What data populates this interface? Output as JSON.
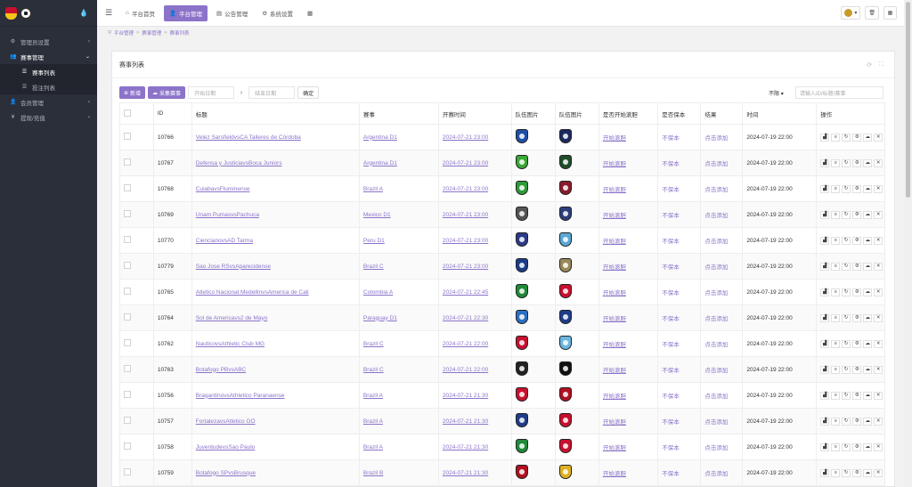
{
  "sidebar": {
    "menu": [
      {
        "label": "管理员设置",
        "icon": "gear-icon",
        "state": "closed"
      },
      {
        "label": "赛事管理",
        "icon": "users-icon",
        "state": "open"
      },
      {
        "label": "赛事列表",
        "icon": "list-icon",
        "state": "sub-active"
      },
      {
        "label": "投注列表",
        "icon": "list-icon",
        "state": "sub"
      },
      {
        "label": "会员管理",
        "icon": "user-icon",
        "state": "closed"
      },
      {
        "label": "提现/充值",
        "icon": "money-icon",
        "state": "closed"
      }
    ]
  },
  "topbar": {
    "tabs": [
      {
        "label": "平台首页",
        "icon": "home-icon",
        "active": false
      },
      {
        "label": "平台管理",
        "icon": "user-icon",
        "active": true
      },
      {
        "label": "公告管理",
        "icon": "notice-icon",
        "active": false
      },
      {
        "label": "系统设置",
        "icon": "gear-icon",
        "active": false
      }
    ]
  },
  "breadcrumb": [
    "平台管理",
    "赛事管理",
    "赛事列表"
  ],
  "panel": {
    "title": "赛事列表",
    "add_label": "新增",
    "collect_label": "采集赛事",
    "start_date_placeholder": "开始日期",
    "end_date_placeholder": "结束日期",
    "confirm_label": "确定",
    "filter_value": "不限",
    "search_placeholder": "请输入ID/标题/赛事"
  },
  "table": {
    "headers": [
      "ID",
      "标题",
      "赛事",
      "开赛时间",
      "队伍图片",
      "队伍图片",
      "是否开始滚胆",
      "是否保本",
      "结果",
      "时间",
      "操作"
    ],
    "rows": [
      {
        "id": "10766",
        "title": "Velez SarsfieldvsCA Talleres de Córdoba",
        "league": "Argentina D1",
        "start": "2024-07-21 23:00",
        "c1": "#1e4fa8",
        "c2": "#1a2b5e",
        "rolling": "开始滚胆",
        "protect": "不保本",
        "result": "点击添加",
        "time": "2024-07-19 22:00"
      },
      {
        "id": "10767",
        "title": "Defensa y JusticiavsBoca Juniors",
        "league": "Argentina D1",
        "start": "2024-07-21 23:00",
        "c1": "#3aa835",
        "c2": "#1f4d2a",
        "rolling": "开始滚胆",
        "protect": "不保本",
        "result": "点击添加",
        "time": "2024-07-19 22:00"
      },
      {
        "id": "10768",
        "title": "CuiabavsFluminense",
        "league": "Brazil A",
        "start": "2024-07-21 23:00",
        "c1": "#2e9a3a",
        "c2": "#8a1c2b",
        "rolling": "开始滚胆",
        "protect": "不保本",
        "result": "点击添加",
        "time": "2024-07-19 22:00"
      },
      {
        "id": "10769",
        "title": "Unam PumasvsPachuca",
        "league": "Mexico D1",
        "start": "2024-07-21 23:00",
        "c1": "#555555",
        "c2": "#2b3e7a",
        "rolling": "开始滚胆",
        "protect": "不保本",
        "result": "点击添加",
        "time": "2024-07-19 22:00"
      },
      {
        "id": "10770",
        "title": "CiencianovsAD Tarma",
        "league": "Peru D1",
        "start": "2024-07-21 23:00",
        "c1": "#2c3a8a",
        "c2": "#5aa7d6",
        "rolling": "开始滚胆",
        "protect": "不保本",
        "result": "点击添加",
        "time": "2024-07-19 22:00"
      },
      {
        "id": "10779",
        "title": "Sao Jose RSvsAparecidense",
        "league": "Brazil C",
        "start": "2024-07-21 23:00",
        "c1": "#1a3c8a",
        "c2": "#9a8a5a",
        "rolling": "开始滚胆",
        "protect": "不保本",
        "result": "点击添加",
        "time": "2024-07-19 22:00"
      },
      {
        "id": "10765",
        "title": "Atletico Nacional MedellinvsAmerica de Cali",
        "league": "Colombia A",
        "start": "2024-07-21 22:45",
        "c1": "#1f8a3a",
        "c2": "#c8102e",
        "rolling": "开始滚胆",
        "protect": "不保本",
        "result": "点击添加",
        "time": "2024-07-19 22:00"
      },
      {
        "id": "10764",
        "title": "Sol de Americavs2 de Mayo",
        "league": "Paraguay D1",
        "start": "2024-07-21 22:30",
        "c1": "#2a6fc2",
        "c2": "#1f3d8a",
        "rolling": "开始滚胆",
        "protect": "不保本",
        "result": "点击添加",
        "time": "2024-07-19 22:00"
      },
      {
        "id": "10762",
        "title": "NauticovsAthletic Club MG",
        "league": "Brazil C",
        "start": "2024-07-21 22:00",
        "c1": "#c8102e",
        "c2": "#6ab7e0",
        "rolling": "开始滚胆",
        "protect": "不保本",
        "result": "点击添加",
        "time": "2024-07-19 22:00"
      },
      {
        "id": "10763",
        "title": "Botafogo PBvsABC",
        "league": "Brazil C",
        "start": "2024-07-21 22:00",
        "c1": "#222222",
        "c2": "#111111",
        "rolling": "开始滚胆",
        "protect": "不保本",
        "result": "点击添加",
        "time": "2024-07-19 22:00"
      },
      {
        "id": "10756",
        "title": "BragantinovsAthletico Paranaense",
        "league": "Brazil A",
        "start": "2024-07-21 21:30",
        "c1": "#c8102e",
        "c2": "#b01020",
        "rolling": "开始滚胆",
        "protect": "不保本",
        "result": "点击添加",
        "time": "2024-07-19 22:00"
      },
      {
        "id": "10757",
        "title": "FortalezavsAtletico GO",
        "league": "Brazil A",
        "start": "2024-07-21 21:30",
        "c1": "#1f3d8a",
        "c2": "#c8102e",
        "rolling": "开始滚胆",
        "protect": "不保本",
        "result": "点击添加",
        "time": "2024-07-19 22:00"
      },
      {
        "id": "10758",
        "title": "JuventudevsSao Paulo",
        "league": "Brazil A",
        "start": "2024-07-21 21:30",
        "c1": "#1f8a3a",
        "c2": "#c8102e",
        "rolling": "开始滚胆",
        "protect": "不保本",
        "result": "点击添加",
        "time": "2024-07-19 22:00"
      },
      {
        "id": "10759",
        "title": "Botafogo SPvsBrusque",
        "league": "Brazil B",
        "start": "2024-07-21 21:30",
        "c1": "#b01020",
        "c2": "#e0b020",
        "rolling": "开始滚胆",
        "protect": "不保本",
        "result": "点击添加",
        "time": "2024-07-19 22:00"
      }
    ]
  }
}
